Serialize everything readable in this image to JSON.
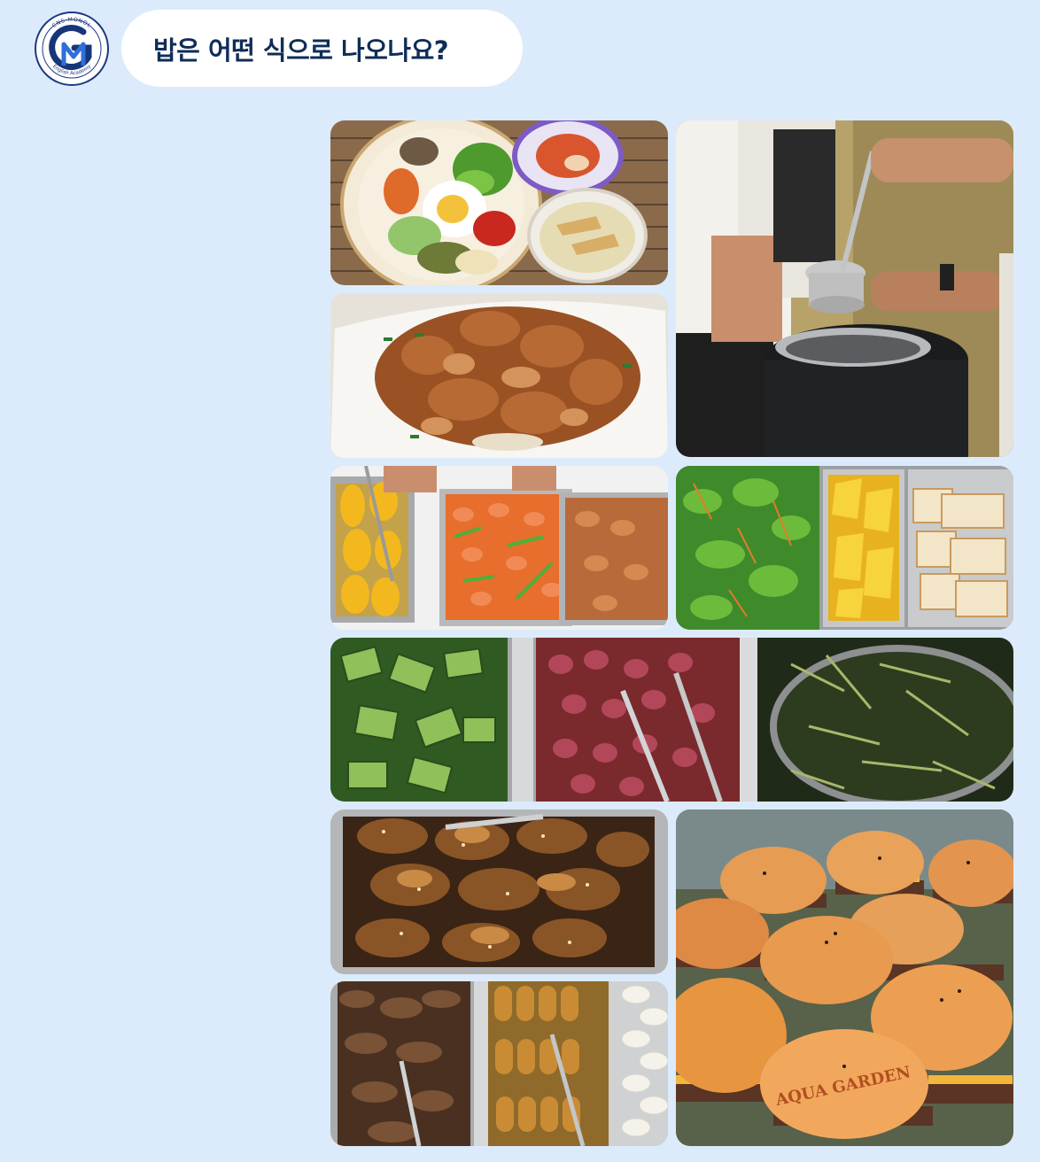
{
  "header": {
    "logo": {
      "ring_text_top": "CNS-MONOL",
      "ring_text_bottom": "English Academy",
      "monogram": "GM",
      "colors": {
        "navy": "#16357a",
        "ring": "#1d3a80",
        "accent": "#2f6fd8"
      }
    }
  },
  "chat": {
    "question": "밥은 어떤 식으로 나오나요?"
  },
  "photos": [
    {
      "id": "bibimbap",
      "icon": "bibimbap-photo"
    },
    {
      "id": "soup-serving",
      "icon": "soup-ladle-photo"
    },
    {
      "id": "spicy-pork",
      "icon": "spicy-pork-photo"
    },
    {
      "id": "mango-shrimp",
      "icon": "buffet-shrimp-photo"
    },
    {
      "id": "salad-pineapple-bread",
      "icon": "buffet-salad-photo"
    },
    {
      "id": "cucumber-grapes-greens",
      "icon": "buffet-sides-photo"
    },
    {
      "id": "grilled-chicken",
      "icon": "grilled-chicken-photo"
    },
    {
      "id": "burgers",
      "icon": "burgers-photo",
      "bun_text": "AQUA GARDEN"
    },
    {
      "id": "beef-sausages",
      "icon": "beef-sausage-photo"
    }
  ],
  "theme": {
    "background": "#dcebfb",
    "bubble": "#ffffff",
    "text": "#0f2d57"
  }
}
